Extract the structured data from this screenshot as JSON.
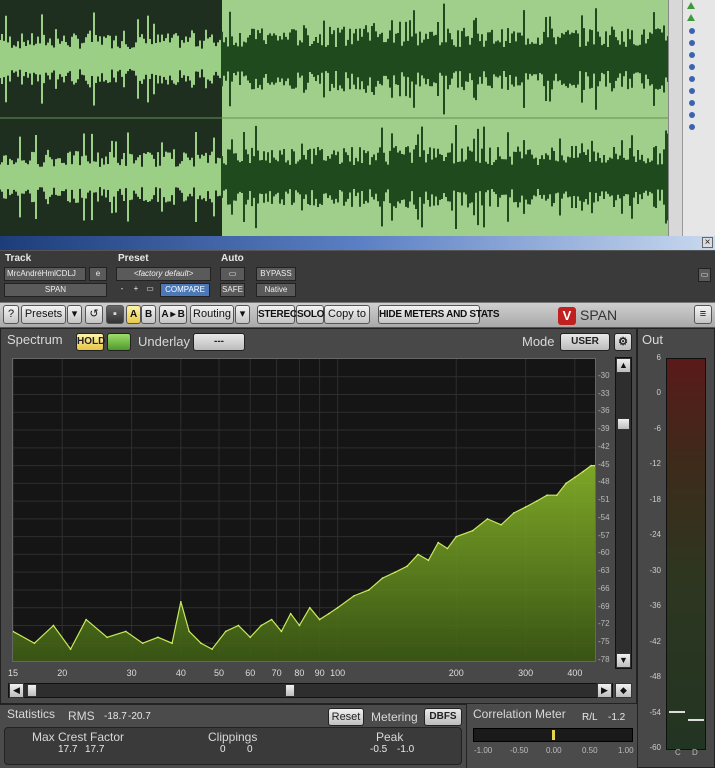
{
  "track": {
    "header": "Track",
    "name": "MrcAndréHmlCDLJ",
    "name_suffix": "e",
    "channel": "SPAN"
  },
  "preset": {
    "header": "Preset",
    "value": "<factory default>",
    "minus": "-",
    "plus": "+",
    "compare": "COMPARE"
  },
  "auto": {
    "header": "Auto",
    "safe": "SAFE",
    "bypass": "BYPASS",
    "native": "Native"
  },
  "toolbar": {
    "help": "?",
    "presets": "Presets",
    "ab_a": "A",
    "ab_b": "B",
    "a_to_b": "A ▸ B",
    "routing": "Routing",
    "stereo": "STEREO",
    "solo": "SOLO",
    "copy_to": "Copy to",
    "hide_meters": "HIDE METERS AND STATS",
    "brand": "SPAN",
    "brand_mark": "V"
  },
  "spectrum": {
    "label": "Spectrum",
    "hold": "HOLD",
    "underlay_label": "Underlay",
    "underlay_value": "---",
    "mode_label": "Mode",
    "mode_value": "USER"
  },
  "chart_data": {
    "type": "area",
    "x_scale": "log",
    "xlim": [
      15,
      450
    ],
    "ylim": [
      -78,
      -27
    ],
    "x_ticks": [
      "15",
      "20",
      "30",
      "40",
      "50",
      "60",
      "70",
      "80",
      "90",
      "100",
      "200",
      "300",
      "400"
    ],
    "y_ticks": [
      "-30",
      "-33",
      "-36",
      "-39",
      "-42",
      "-45",
      "-48",
      "-51",
      "-54",
      "-57",
      "-60",
      "-63",
      "-66",
      "-69",
      "-72",
      "-75",
      "-78"
    ],
    "x": [
      15,
      17,
      19,
      21,
      23,
      26,
      29,
      32,
      35,
      38,
      40,
      42,
      45,
      48,
      52,
      56,
      60,
      64,
      68,
      72,
      76,
      80,
      85,
      90,
      95,
      100,
      110,
      120,
      130,
      140,
      150,
      160,
      170,
      180,
      190,
      200,
      220,
      240,
      260,
      280,
      300,
      320,
      340,
      360,
      380,
      400,
      420,
      440,
      450
    ],
    "y": [
      -73,
      -75,
      -72,
      -76,
      -71,
      -74,
      -73,
      -75,
      -74,
      -75,
      -68,
      -73,
      -75,
      -76,
      -73,
      -72,
      -74,
      -72,
      -71,
      -73,
      -70,
      -72,
      -69,
      -71,
      -70,
      -69,
      -67,
      -66,
      -64,
      -63,
      -62,
      -60,
      -61,
      -58,
      -59,
      -57,
      -56,
      -54,
      -55,
      -53,
      -52,
      -51,
      -50,
      -50,
      -48,
      -47,
      -46,
      -45,
      -45
    ],
    "color": "#8fbf2a"
  },
  "out_meter": {
    "label": "Out",
    "ticks": [
      "6",
      "0",
      "-6",
      "-12",
      "-18",
      "-24",
      "-30",
      "-36",
      "-42",
      "-48",
      "-54",
      "-60"
    ],
    "ch_c": "C",
    "ch_d": "D",
    "ylim": [
      -60,
      6
    ],
    "peak_c": -53.5,
    "peak_d": -55
  },
  "statistics": {
    "label": "Statistics",
    "rms_label": "RMS",
    "rms_l": "-18.7",
    "rms_r": "-20.7",
    "reset": "Reset",
    "metering_label": "Metering",
    "metering_value": "DBFS",
    "crest_label": "Max Crest Factor",
    "crest_l": "17.7",
    "crest_r": "17.7",
    "clip_label": "Clippings",
    "clip_l": "0",
    "clip_r": "0",
    "peak_label": "Peak",
    "peak_l": "-0.5",
    "peak_r": "-1.0"
  },
  "correlation": {
    "label": "Correlation Meter",
    "rl_label": "R/L",
    "rl_value": "-1.2",
    "ticks": [
      "-1.00",
      "-0.50",
      "0.00",
      "0.50",
      "1.00"
    ],
    "value": 0.0
  }
}
